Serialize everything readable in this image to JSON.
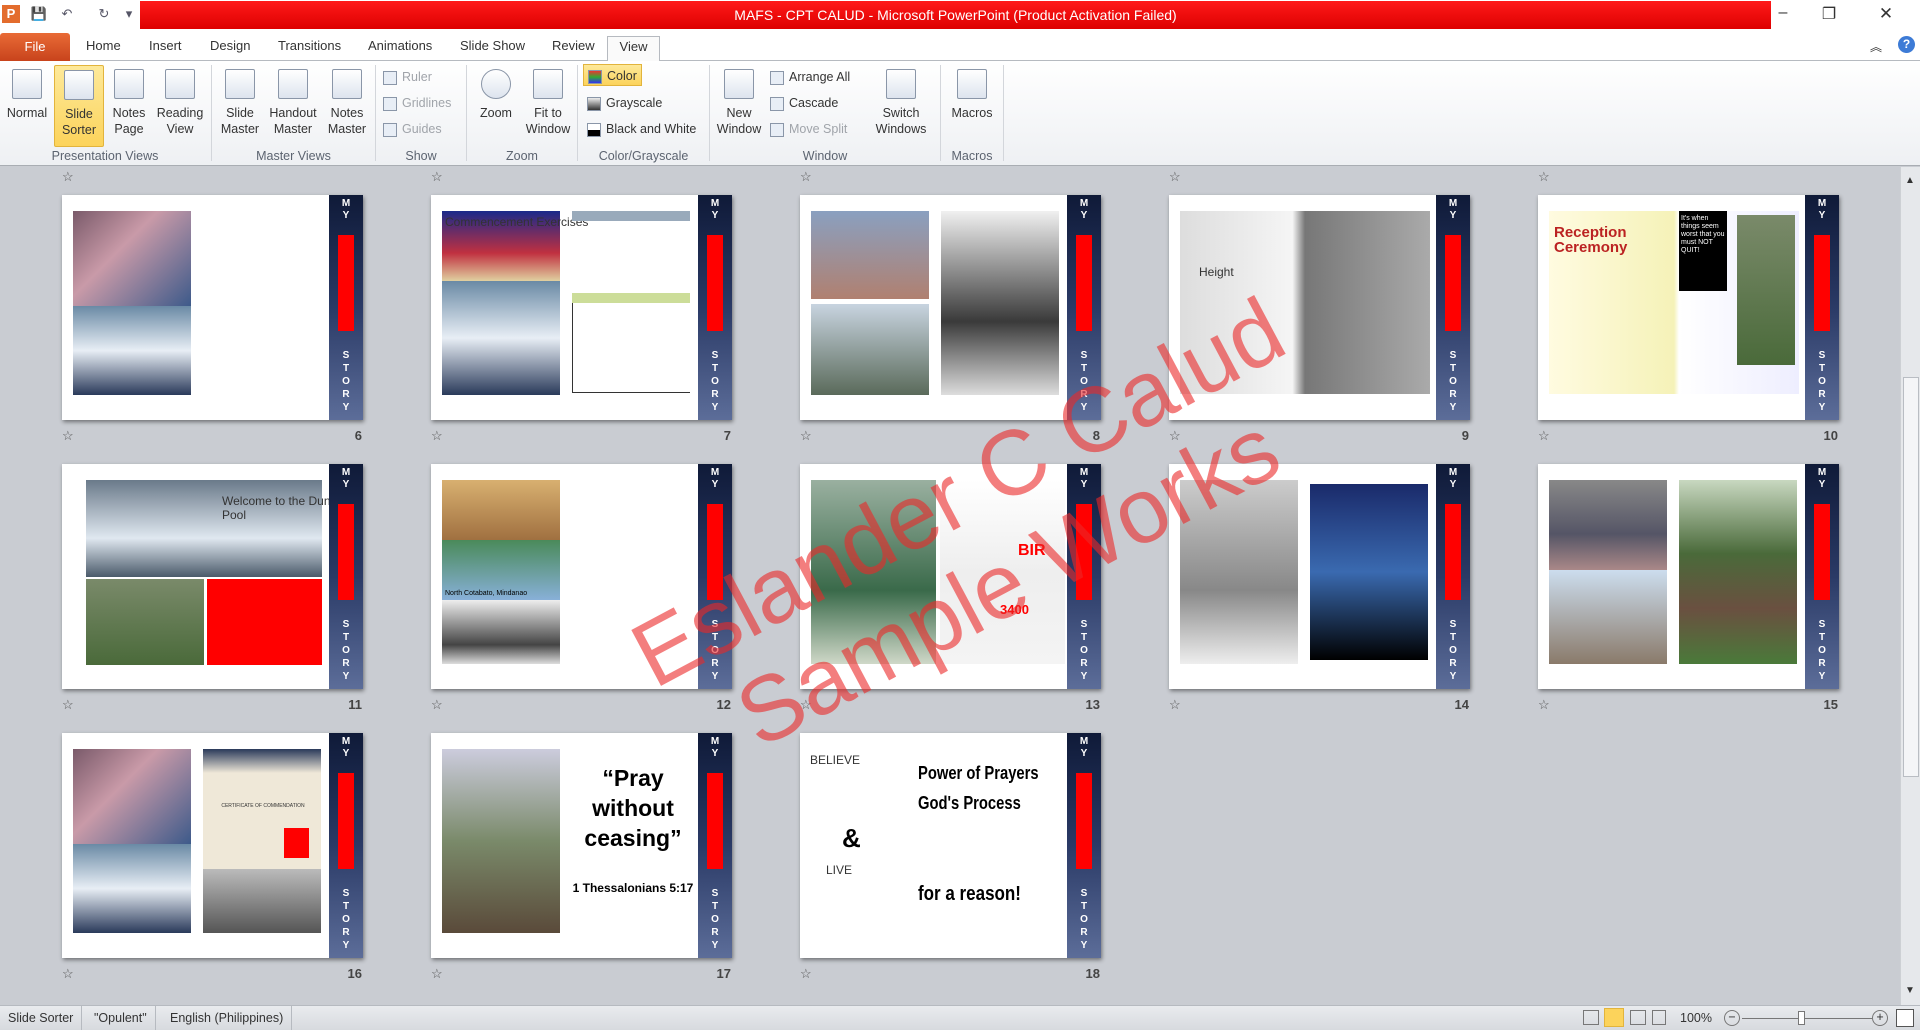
{
  "window": {
    "title": "MAFS - CPT CALUD  -  Microsoft PowerPoint (Product Activation Failed)",
    "minimize": "–",
    "restore": "❐",
    "close": "✕"
  },
  "qat": {
    "app_icon": "P",
    "save": "💾",
    "undo": "↶",
    "redo": "↻",
    "customize": "▾"
  },
  "tabs": {
    "file": "File",
    "items": [
      "Home",
      "Insert",
      "Design",
      "Transitions",
      "Animations",
      "Slide Show",
      "Review",
      "View"
    ],
    "active": "View"
  },
  "ribbon": {
    "presentation_views": {
      "label": "Presentation Views",
      "normal": "Normal",
      "slide_sorter": "Slide Sorter",
      "notes_page": "Notes Page",
      "reading_view": "Reading View"
    },
    "master_views": {
      "label": "Master Views",
      "slide_master": "Slide Master",
      "handout_master": "Handout Master",
      "notes_master": "Notes Master"
    },
    "show": {
      "label": "Show",
      "ruler": "Ruler",
      "gridlines": "Gridlines",
      "guides": "Guides"
    },
    "zoom": {
      "label": "Zoom",
      "zoom": "Zoom",
      "fit": "Fit to Window"
    },
    "color": {
      "label": "Color/Grayscale",
      "color": "Color",
      "grayscale": "Grayscale",
      "bw": "Black and White"
    },
    "window": {
      "label": "Window",
      "new_window": "New Window",
      "arrange_all": "Arrange All",
      "cascade": "Cascade",
      "move_split": "Move Split",
      "switch_windows": "Switch Windows"
    },
    "macros": {
      "label": "Macros",
      "macros": "Macros"
    }
  },
  "sidebar_text": {
    "my": "M Y",
    "story": "S T O R Y"
  },
  "slides": [
    {
      "num": "6"
    },
    {
      "num": "7",
      "caption": "Commencement Exercises"
    },
    {
      "num": "8"
    },
    {
      "num": "9",
      "caption": "Height"
    },
    {
      "num": "10",
      "caption": "Reception Ceremony",
      "quote": "It's when things seem worst that you must NOT QUIT!"
    },
    {
      "num": "11",
      "caption": "Welcome to the Dunking Pool"
    },
    {
      "num": "12",
      "caption": "North Cotabato, Mindanao"
    },
    {
      "num": "13",
      "caption": "BIR",
      "amount": "3400"
    },
    {
      "num": "14"
    },
    {
      "num": "15"
    },
    {
      "num": "16",
      "caption": "CERTIFICATE OF COMMENDATION"
    },
    {
      "num": "17",
      "quote": "“Pray without ceasing”",
      "ref": "1 Thessalonians 5:17"
    },
    {
      "num": "18",
      "believe": "BELIEVE",
      "amp": "&",
      "live": "LIVE",
      "power": "Power of Prayers",
      "process": "God's Process",
      "reason": "for a reason!"
    }
  ],
  "watermark": {
    "line1": "Eslander C Calud",
    "line2": "Sample Works"
  },
  "status": {
    "view": "Slide Sorter",
    "theme": "\"Opulent\"",
    "language": "English (Philippines)",
    "zoom": "100%"
  },
  "zoom_level_percent": 100,
  "colors": {
    "title_red": "#e00000",
    "file_orange": "#d4522a",
    "accent_red": "#ff0000",
    "sidebar_navy": "#1a2650"
  }
}
